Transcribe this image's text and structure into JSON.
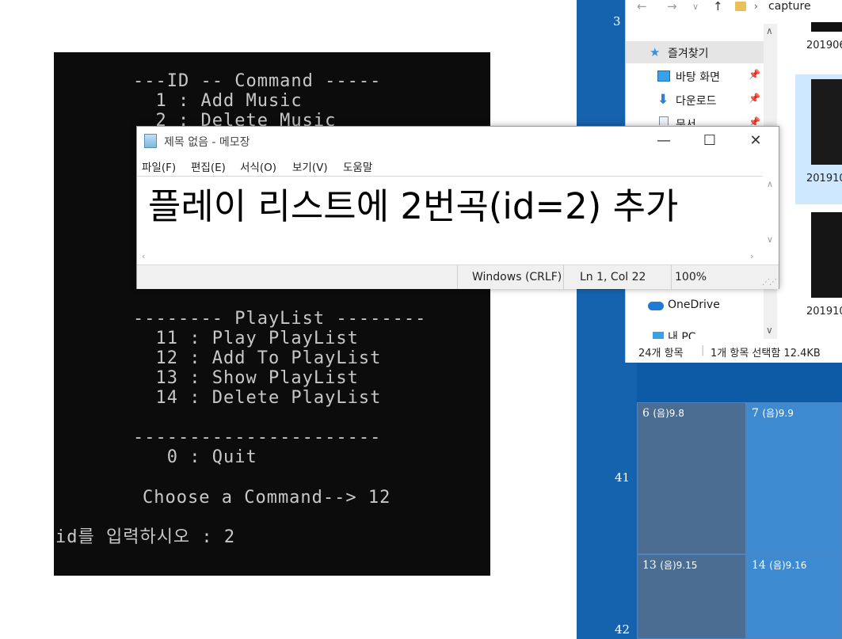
{
  "console": {
    "lines": [
      "---ID -- Command -----",
      "  1 : Add Music",
      "  2 : Delete Music",
      "-------- PlayList --------",
      "  11 : Play PlayList",
      "  12 : Add To PlayList",
      "  13 : Show PlayList",
      "  14 : Delete PlayList",
      "----------------------",
      "   0 : Quit",
      "Choose a Command--> 12",
      "id를 입력하시오 : 2"
    ]
  },
  "notepad": {
    "title": "제목 없음 - 메모장",
    "menu": [
      "파일(F)",
      "편집(E)",
      "서식(O)",
      "보기(V)",
      "도움말"
    ],
    "content": "플레이 리스트에 2번곡(id=2) 추가",
    "status": {
      "line_ending": "Windows (CRLF)",
      "position": "Ln 1, Col 22",
      "zoom": "100%"
    },
    "buttons": {
      "minimize": "—",
      "maximize": "☐",
      "close": "✕"
    }
  },
  "explorer": {
    "breadcrumb": "capture",
    "tree": [
      {
        "label": "즐겨찾기",
        "icon": "star-icon"
      },
      {
        "label": "바탕 화면",
        "icon": "desktop-icon"
      },
      {
        "label": "다운로드",
        "icon": "download-icon"
      },
      {
        "label": "문서",
        "icon": "document-icon"
      },
      {
        "label": "OneDrive",
        "icon": "cloud-icon"
      },
      {
        "label": "내 PC",
        "icon": "pc-icon"
      }
    ],
    "thumbnails": [
      "201906",
      "201910",
      "201910"
    ],
    "status": {
      "count": "24개 항목",
      "selected": "1개 항목 선택함 12.4KB"
    }
  },
  "calendar": {
    "week_numbers": [
      "3",
      "41",
      "42"
    ],
    "cells": [
      {
        "day": "6",
        "lunar": "(음)9.8"
      },
      {
        "day": "7",
        "lunar": "(음)9.9"
      },
      {
        "day": "13",
        "lunar": "(음)9.15"
      },
      {
        "day": "14",
        "lunar": "(음)9.16"
      }
    ]
  }
}
